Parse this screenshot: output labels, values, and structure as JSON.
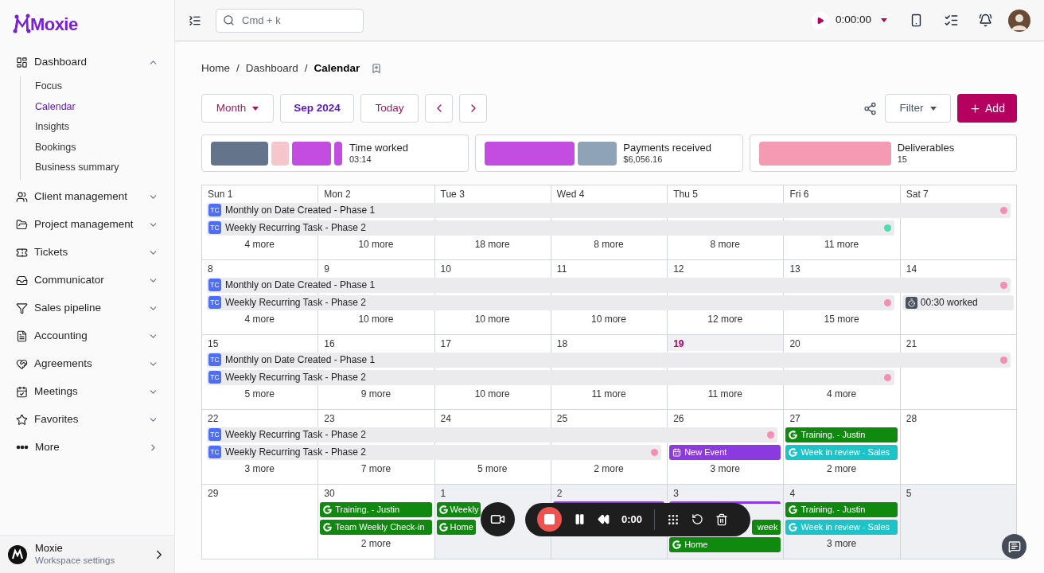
{
  "sidebar": {
    "logo": "Moxie",
    "items": [
      {
        "label": "Dashboard",
        "kind": "group",
        "expanded": true,
        "children": [
          {
            "label": "Focus",
            "selected": false
          },
          {
            "label": "Calendar",
            "selected": true
          },
          {
            "label": "Insights",
            "selected": false
          },
          {
            "label": "Bookings",
            "selected": false
          },
          {
            "label": "Business summary",
            "selected": false
          }
        ]
      },
      {
        "label": "Client management",
        "kind": "group",
        "expanded": false
      },
      {
        "label": "Project management",
        "kind": "group",
        "expanded": false
      },
      {
        "label": "Tickets",
        "kind": "group",
        "expanded": false
      },
      {
        "label": "Communicator",
        "kind": "group",
        "expanded": false
      },
      {
        "label": "Sales pipeline",
        "kind": "group",
        "expanded": false
      },
      {
        "label": "Accounting",
        "kind": "group",
        "expanded": false
      },
      {
        "label": "Agreements",
        "kind": "group",
        "expanded": false
      },
      {
        "label": "Meetings",
        "kind": "group",
        "expanded": false
      },
      {
        "label": "Favorites",
        "kind": "group",
        "expanded": false
      },
      {
        "label": "More",
        "kind": "link",
        "expanded": false
      }
    ],
    "workspace": {
      "name": "Moxie",
      "subtitle": "Workspace settings"
    }
  },
  "topbar": {
    "search": {
      "placeholder": "Cmd + k"
    },
    "timer": "0:00:00"
  },
  "breadcrumb": [
    {
      "kind": "link",
      "text": "Home"
    },
    {
      "kind": "separator",
      "text": "/"
    },
    {
      "kind": "link",
      "text": "Dashboard"
    },
    {
      "kind": "separator",
      "text": "/"
    },
    {
      "kind": "current",
      "text": "Calendar"
    }
  ],
  "toolbar": {
    "view": "Month",
    "period": "Sep 2024",
    "today": "Today",
    "filter": "Filter",
    "add": "Add"
  },
  "legend": [
    {
      "label": "Time worked",
      "value": "03:14",
      "segments": [
        {
          "color": "#64748b",
          "kind": "long"
        },
        {
          "color": "#f5c6cc",
          "kind": "small"
        },
        {
          "color": "#c24de0",
          "kind": "medium"
        },
        {
          "color": "#c24de0",
          "kind": "narrow"
        }
      ]
    },
    {
      "label": "Payments received",
      "value": "$6,056.16",
      "segments": [
        {
          "color": "#c24de0",
          "kind": "wide"
        },
        {
          "color": "#8ea3b5",
          "kind": "medium"
        }
      ]
    },
    {
      "label": "Deliverables",
      "value": "15",
      "segments": [
        {
          "color": "#f49ab3",
          "kind": "full"
        }
      ]
    }
  ],
  "weeks": [
    {
      "bars": [
        {
          "badge": "TC",
          "title": "Monthly on Date Created - Phase 1",
          "kind": "span7",
          "color": "#f48fb1"
        },
        {
          "badge": "TC",
          "title": "Weekly Recurring Task - Phase 2",
          "kind": "span6",
          "color": "#4fdcb2"
        }
      ],
      "days": [
        {
          "label": "Sun 1",
          "more": "4 more",
          "today": false,
          "outside": false
        },
        {
          "label": "Mon 2",
          "more": "10 more",
          "today": false,
          "outside": false
        },
        {
          "label": "Tue 3",
          "more": "18 more",
          "today": false,
          "outside": false
        },
        {
          "label": "Wed 4",
          "more": "8 more",
          "today": false,
          "outside": false
        },
        {
          "label": "Thu 5",
          "more": "8 more",
          "today": false,
          "outside": false
        },
        {
          "label": "Fri 6",
          "more": "11 more",
          "today": false,
          "outside": false
        },
        {
          "label": "Sat 7",
          "today": false,
          "outside": false
        }
      ]
    },
    {
      "bars": [
        {
          "badge": "TC",
          "title": "Monthly on Date Created - Phase 1",
          "kind": "span7",
          "color": "#f48fb1"
        },
        {
          "badge": "TC",
          "title": "Weekly Recurring Task - Phase 2",
          "kind": "span6",
          "color": "#f48fb1"
        }
      ],
      "days": [
        {
          "label": "8",
          "more": "4 more",
          "today": false,
          "outside": false
        },
        {
          "label": "9",
          "more": "10 more",
          "today": false,
          "outside": false
        },
        {
          "label": "10",
          "more": "10 more",
          "today": false,
          "outside": false
        },
        {
          "label": "11",
          "more": "10 more",
          "today": false,
          "outside": false
        },
        {
          "label": "12",
          "more": "12 more",
          "today": false,
          "outside": false
        },
        {
          "label": "13",
          "more": "15 more",
          "today": false,
          "outside": false
        },
        {
          "label": "14",
          "today": false,
          "outside": false,
          "events": [
            {
              "kind": "timer",
              "title": "00:30 worked"
            }
          ]
        }
      ]
    },
    {
      "bars": [
        {
          "badge": "TC",
          "title": "Monthly on Date Created - Phase 1",
          "kind": "span7",
          "color": "#f48fb1"
        },
        {
          "badge": "TC",
          "title": "Weekly Recurring Task - Phase 2",
          "kind": "span6",
          "color": "#f48fb1"
        }
      ],
      "days": [
        {
          "label": "15",
          "more": "5 more",
          "today": false,
          "outside": false
        },
        {
          "label": "16",
          "more": "9 more",
          "today": false,
          "outside": false
        },
        {
          "label": "17",
          "more": "10 more",
          "today": false,
          "outside": false
        },
        {
          "label": "18",
          "more": "11 more",
          "today": false,
          "outside": false
        },
        {
          "label": "19",
          "more": "11 more",
          "today": true,
          "outside": false
        },
        {
          "label": "20",
          "more": "4 more",
          "today": false,
          "outside": false
        },
        {
          "label": "21",
          "today": false,
          "outside": false
        }
      ]
    },
    {
      "bars": [
        {
          "badge": "TC",
          "title": "Weekly Recurring Task - Phase 2",
          "kind": "span5",
          "color": "#f48fb1"
        },
        {
          "badge": "TC",
          "title": "Weekly Recurring Task - Phase 2",
          "kind": "span4",
          "color": "#f48fb1"
        }
      ],
      "days": [
        {
          "label": "22",
          "more": "3 more",
          "today": false,
          "outside": false
        },
        {
          "label": "23",
          "more": "7 more",
          "today": false,
          "outside": false
        },
        {
          "label": "24",
          "more": "5 more",
          "today": false,
          "outside": false
        },
        {
          "label": "25",
          "more": "2 more",
          "today": false,
          "outside": false
        },
        {
          "label": "26",
          "more": "3 more",
          "today": false,
          "outside": false,
          "events": [
            {
              "kind": "event",
              "title": "New Event",
              "color": "#8b3ae0"
            }
          ]
        },
        {
          "label": "27",
          "more": "2 more",
          "today": false,
          "outside": false,
          "events": [
            {
              "kind": "google",
              "title": "Training. - Justin",
              "color": "#10890f"
            },
            {
              "kind": "google",
              "title": "Week in review - Sales",
              "color": "#1cc4c8"
            }
          ]
        },
        {
          "label": "28",
          "today": false,
          "outside": false
        }
      ]
    },
    {
      "days": [
        {
          "label": "29",
          "today": false,
          "outside": false
        },
        {
          "label": "30",
          "more": "2 more",
          "today": false,
          "outside": false,
          "events": [
            {
              "kind": "google",
              "title": "Training. - Justin",
              "color": "#10890f"
            },
            {
              "kind": "google",
              "title": "Team Weekly Check-in",
              "color": "#10890f"
            }
          ]
        },
        {
          "label": "1",
          "today": false,
          "outside": true,
          "events": [
            {
              "kind": "googleleft",
              "title": "Weekly",
              "color": "#10890f"
            },
            {
              "kind": "googleleft",
              "title": "Home",
              "color": "#10890f"
            }
          ]
        },
        {
          "label": "2",
          "today": false,
          "outside": true,
          "events": [
            {
              "kind": "strip",
              "color": "#8b3ae0"
            }
          ]
        },
        {
          "label": "3",
          "today": false,
          "outside": true,
          "events": [
            {
              "kind": "strip",
              "color": "#8b3ae0"
            },
            {
              "kind": "googleright",
              "title": "week",
              "color": "#10890f"
            },
            {
              "kind": "google",
              "title": "Home",
              "color": "#10890f"
            }
          ]
        },
        {
          "label": "4",
          "more": "3 more",
          "today": false,
          "outside": true,
          "events": [
            {
              "kind": "google",
              "title": "Training. - Justin",
              "color": "#10890f"
            },
            {
              "kind": "google",
              "title": "Week in review - Sales",
              "color": "#1cc4c8"
            }
          ]
        },
        {
          "label": "5",
          "today": false,
          "outside": true
        }
      ]
    }
  ],
  "recorder": {
    "time": "0:00"
  }
}
